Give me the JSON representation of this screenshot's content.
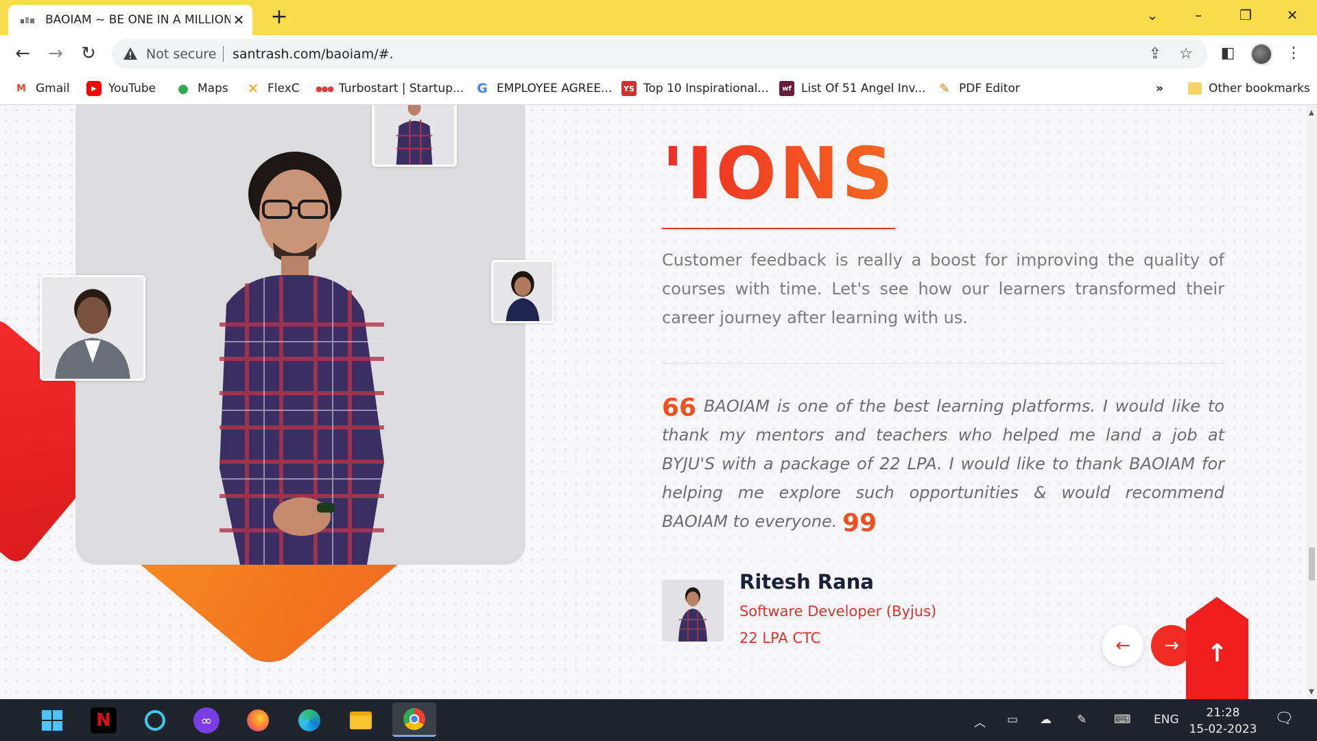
{
  "browser": {
    "tab_title": "BAOIAM ~ BE ONE IN A MILLION",
    "not_secure_label": "Not secure",
    "url": "santrash.com/baoiam/#."
  },
  "bookmarks": {
    "items": [
      {
        "label": "Gmail",
        "icon": "gmail-icon",
        "color": "#ea4335"
      },
      {
        "label": "YouTube",
        "icon": "youtube-icon",
        "color": "#ff0000"
      },
      {
        "label": "Maps",
        "icon": "maps-icon",
        "color": "#34a853"
      },
      {
        "label": "FlexC",
        "icon": "flexc-icon",
        "color": "#f2a900"
      },
      {
        "label": "Turbostart | Startup...",
        "icon": "turbostart-icon",
        "color": "#e53935"
      },
      {
        "label": "EMPLOYEE AGREE...",
        "icon": "google-icon",
        "color": "#4285f4"
      },
      {
        "label": "Top 10 Inspirational...",
        "icon": "yourstory-icon",
        "color": "#d32f2f"
      },
      {
        "label": "List Of 51 Angel Inv...",
        "icon": "wf-icon",
        "color": "#6a1b3a"
      },
      {
        "label": "PDF Editor",
        "icon": "pdf-editor-icon",
        "color": "#f57c00"
      }
    ],
    "overflow_label": "»",
    "other_label": "Other bookmarks"
  },
  "page": {
    "heading": "'IONS",
    "intro": "Customer feedback is really a boost for improving the quality of courses with time. Let's see how our learners transformed their career journey after learning with us.",
    "quote": "BAOIAM is one of the best learning platforms. I would like to thank my mentors and teachers who helped me land a job at BYJU'S with a package of 22 LPA. I would like to thank BAOIAM for helping me explore such opportunities & would recommend BAOIAM to everyone.",
    "quote_open": "66",
    "quote_close": "99",
    "author": {
      "name": "Ritesh Rana",
      "role": "Software Developer (Byjus)",
      "ctc": "22 LPA CTC"
    },
    "prev_label": "←",
    "next_label": "→",
    "to_top_label": "↑",
    "accent_red": "#ef2b24",
    "accent_orange": "#f36a21"
  },
  "taskbar": {
    "language": "ENG",
    "time": "21:28",
    "date": "15-02-2023"
  }
}
